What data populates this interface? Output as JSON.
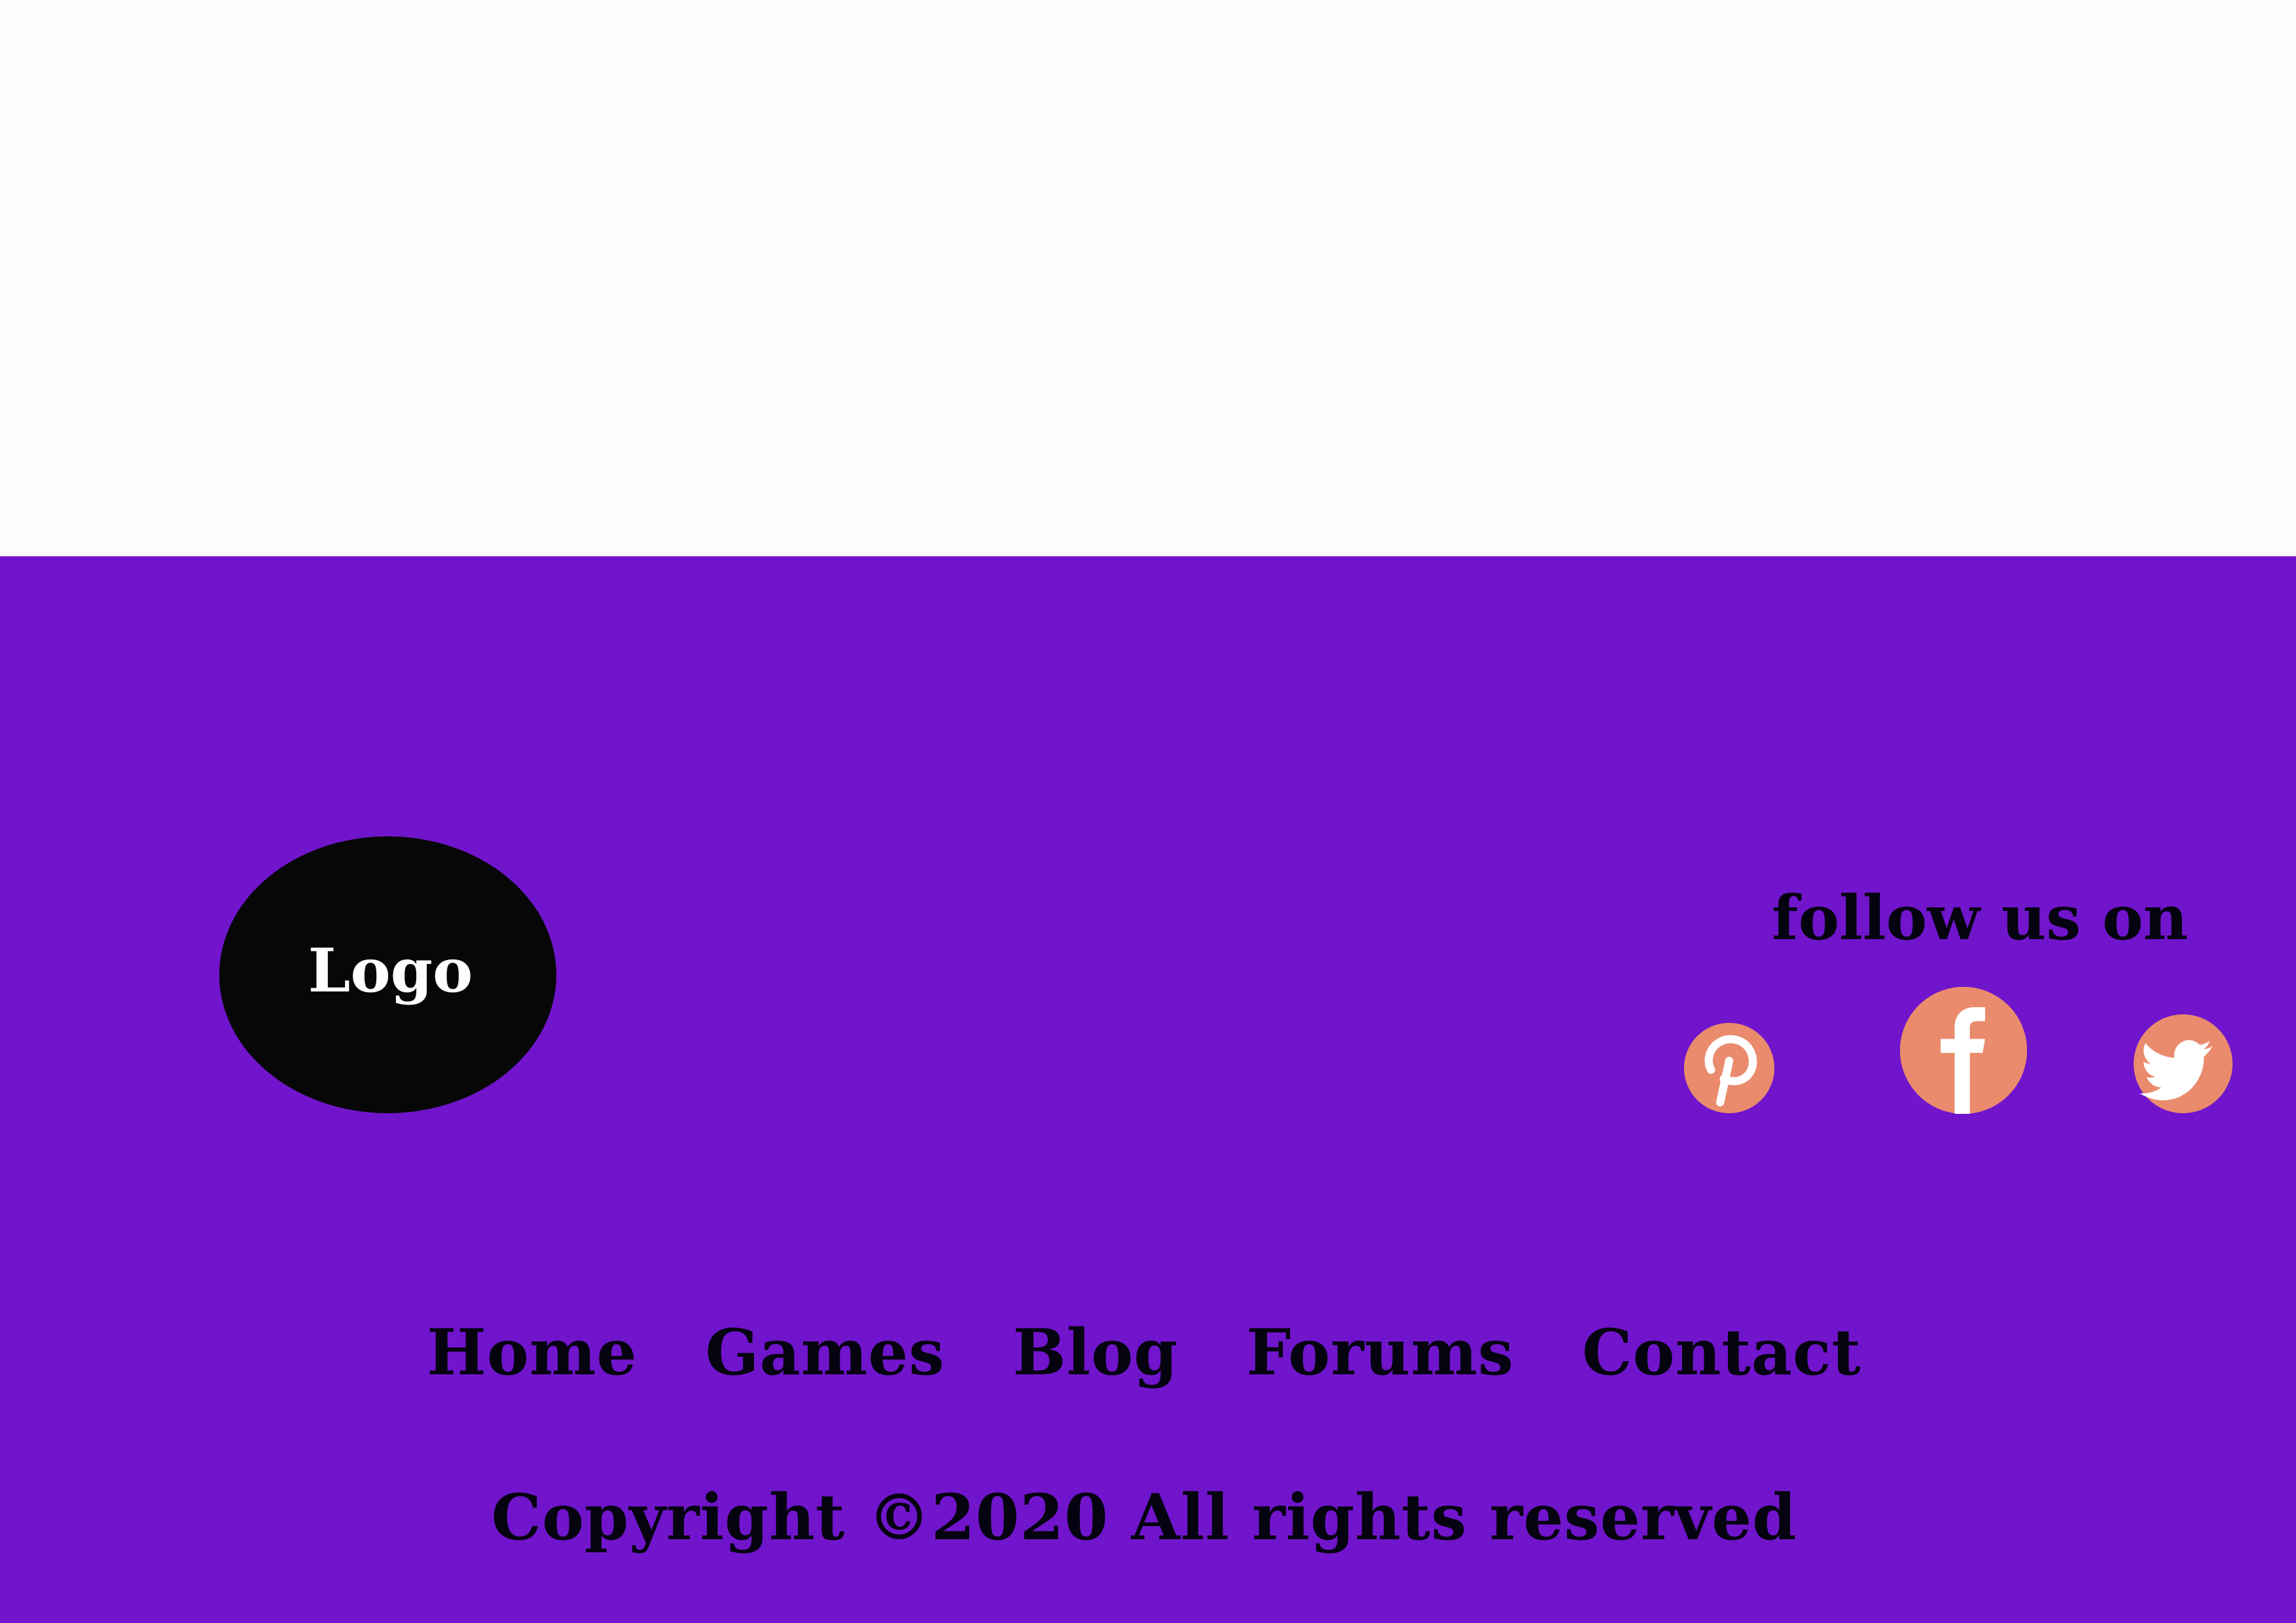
{
  "logo": {
    "text": "Logo"
  },
  "social": {
    "title": "follow us on",
    "icons": [
      "pinterest-icon",
      "facebook-icon",
      "twitter-icon"
    ]
  },
  "nav": {
    "items": [
      {
        "label": "Home"
      },
      {
        "label": "Games"
      },
      {
        "label": "Blog"
      },
      {
        "label": "Forums"
      },
      {
        "label": "Contact"
      }
    ]
  },
  "copyright": "Copyright ©2020 All rights reserved",
  "colors": {
    "footer_bg": "#7015cc",
    "top_bg": "#fdfdfd",
    "logo_bg": "#070707",
    "logo_text": "#ffffff",
    "text": "#050310",
    "social_icon": "#e98b6c"
  }
}
